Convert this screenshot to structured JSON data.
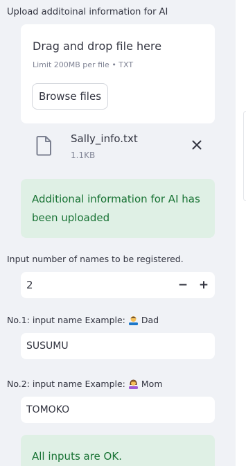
{
  "upload": {
    "label": "Upload additoinal information for AI",
    "dropzone_title": "Drag and drop file here",
    "dropzone_limit": "Limit 200MB per file • TXT",
    "browse_label": "Browse files",
    "file": {
      "name": "Sally_info.txt",
      "size": "1.1KB",
      "icon": "file-icon",
      "remove_icon": "close-icon"
    },
    "success_message": "Additional information for AI has been uploaded"
  },
  "names_count": {
    "label": "Input number of names to be registered.",
    "value": "2",
    "minus_label": "−",
    "plus_label": "+"
  },
  "names": [
    {
      "label_prefix": "No.1: input name Example:",
      "example_avatar": "man-avatar-icon",
      "example": "Dad",
      "value": "SUSUMU"
    },
    {
      "label_prefix": "No.2: input name Example:",
      "example_avatar": "woman-avatar-icon",
      "example": "Mom",
      "value": "TOMOKO"
    }
  ],
  "status": {
    "message": "All inputs are OK."
  },
  "colors": {
    "sidebar_bg": "#f0f2f6",
    "success_bg": "#dff0e5",
    "success_text": "#177233"
  }
}
